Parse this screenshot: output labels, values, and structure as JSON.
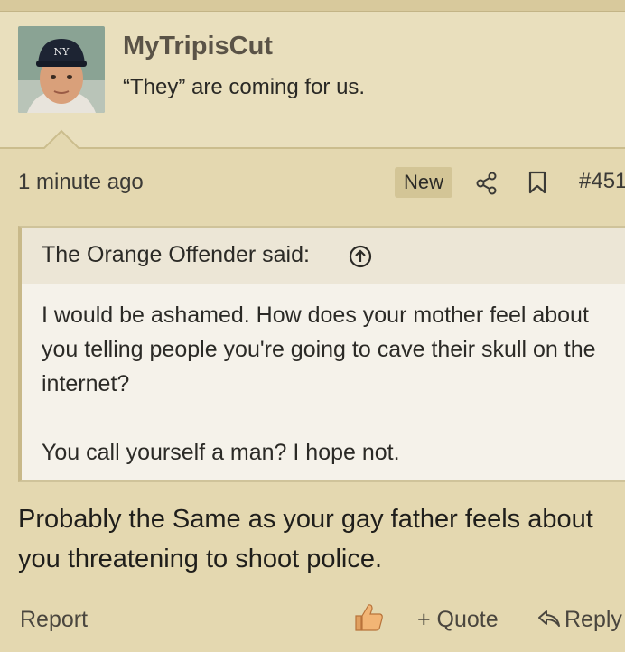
{
  "post": {
    "author": {
      "username": "MyTripisCut",
      "user_title": "“They” are coming for us.",
      "avatar_icon": "avatar-baseball-player"
    },
    "timestamp": "1 minute ago",
    "badge": "New",
    "post_number": "#451",
    "quote": {
      "attribution": "The Orange Offender said:",
      "paragraphs": [
        "I would be ashamed. How does your mother feel about you telling people you're going to cave their skull on the internet?",
        "You call yourself a man? I hope not."
      ]
    },
    "message": "Probably the Same as your gay father feels about you threatening to shoot police.",
    "actions": {
      "report": "Report",
      "quote": "+ Quote",
      "reply": "Reply",
      "like_icon": "thumbs-up-icon"
    }
  },
  "colors": {
    "background": "#e4d8b0",
    "header_background": "#e9dfbd",
    "quote_background": "#f5f2ea",
    "badge_background": "#d3c596",
    "username": "#5a5347"
  }
}
